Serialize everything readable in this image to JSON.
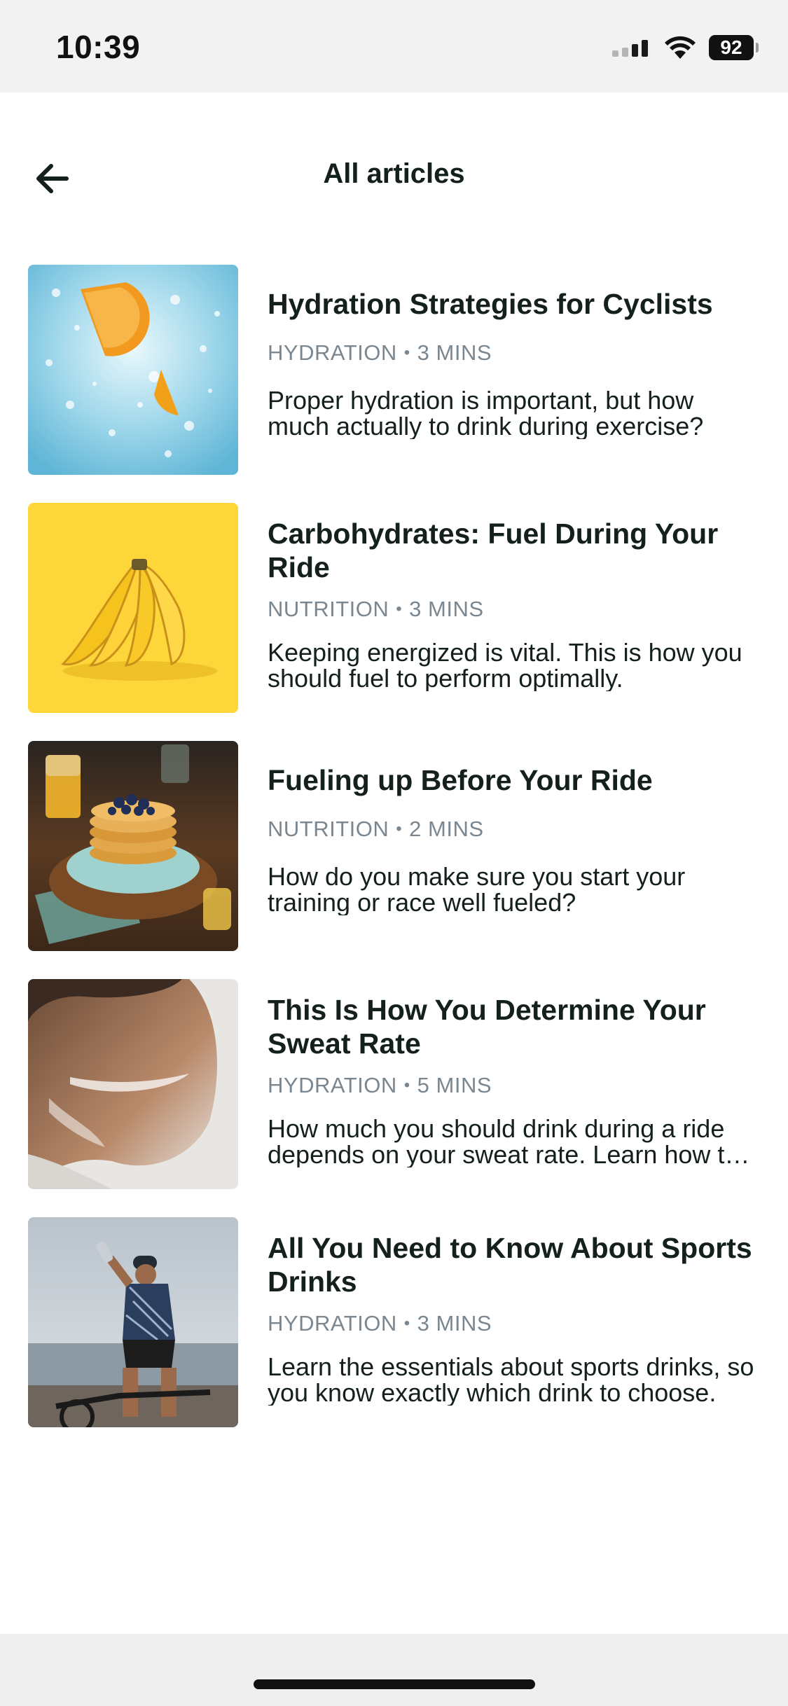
{
  "status_bar": {
    "time": "10:39",
    "battery": "92",
    "icons": [
      "cellular-signal-icon",
      "wifi-icon",
      "battery-icon"
    ]
  },
  "header": {
    "title": "All articles",
    "back_icon": "arrow-left-icon"
  },
  "articles": [
    {
      "title": "Hydration Strategies for Cyclists",
      "category": "HYDRATION",
      "duration": "3 MINS",
      "excerpt": "Proper hydration is important, but how much actually to drink during exercise?",
      "image": "orange-slices-in-water-photo"
    },
    {
      "title": "Carbohydrates: Fuel During Your Ride",
      "category": "NUTRITION",
      "duration": "3 MINS",
      "excerpt": "Keeping energized is vital. This is how you should fuel to perform optimally.",
      "image": "bananas-on-yellow-photo"
    },
    {
      "title": "Fueling up Before Your Ride",
      "category": "NUTRITION",
      "duration": "2 MINS",
      "excerpt": "How do you make sure you start your training or race well fueled?",
      "image": "pancakes-with-blueberries-photo"
    },
    {
      "title": "This Is How You Determine Your Sweat Rate",
      "category": "HYDRATION",
      "duration": "5 MINS",
      "excerpt": "How much you should drink during a ride depends on your sweat rate. Learn how to measure it.",
      "image": "sweating-face-photo"
    },
    {
      "title": "All You Need to Know About Sports Drinks",
      "category": "HYDRATION",
      "duration": "3 MINS",
      "excerpt": "Learn the essentials about sports drinks, so you know exactly which drink to choose.",
      "image": "cyclist-drinking-photo"
    }
  ],
  "colors": {
    "title_text": "#14201c",
    "meta_text": "#7a8790",
    "status_bar_bg": "#f2f2f2",
    "background": "#ffffff"
  }
}
